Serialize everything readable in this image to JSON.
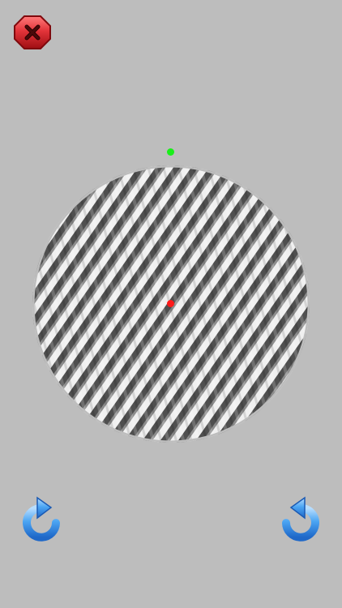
{
  "icons": {
    "close": "close-icon",
    "rotate_counterclockwise": "rotate-counterclockwise-icon",
    "rotate_clockwise": "rotate-clockwise-icon"
  },
  "colors": {
    "background": "#bdbdbd",
    "close_button": "#d7262b",
    "fixation_dot": "#ff1a1a",
    "target_dot": "#19ef19",
    "rotate_arrow": "#2f8ee6",
    "pattern_light": "#f2f2f2",
    "pattern_dark": "#4f4f4f"
  },
  "stimulus": {
    "type": "circular-grating",
    "orientation": "diagonal"
  }
}
